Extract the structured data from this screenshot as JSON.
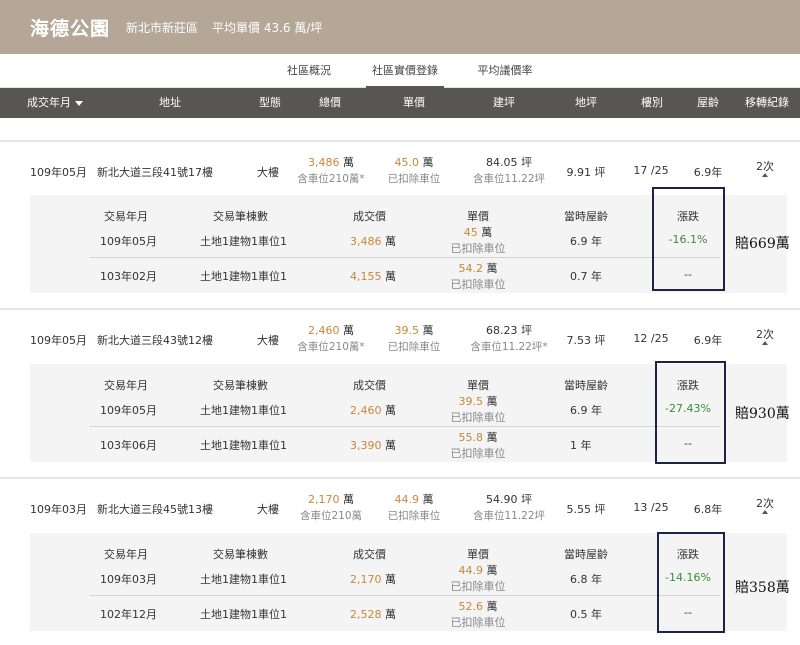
{
  "header": {
    "community_name": "海德公園",
    "region": "新北市新莊區",
    "avg_price": "平均單價 43.6 萬/坪"
  },
  "tabs": [
    {
      "label": "社區概況"
    },
    {
      "label": "社區實價登錄"
    },
    {
      "label": "平均議價率"
    }
  ],
  "columns": {
    "date": "成交年月",
    "address": "地址",
    "type": "型態",
    "total": "總價",
    "unit": "單價",
    "building_area": "建坪",
    "land_area": "地坪",
    "floor": "樓別",
    "age": "屋齡",
    "history": "移轉紀錄"
  },
  "detail_headers": {
    "date": "交易年月",
    "count": "交易筆棟數",
    "price": "成交價",
    "unit": "單價",
    "age": "當時屋齡",
    "change": "漲跌"
  },
  "records": [
    {
      "date": "109年05月",
      "address": "新北大道三段41號17樓",
      "type": "大樓",
      "total": "3,486",
      "total_unit": "萬",
      "total_sub": "含車位210萬*",
      "unit_price": "45.0",
      "unit_price_unit": "萬",
      "unit_sub": "已扣除車位",
      "area": "84.05 坪",
      "area_sub": "含車位11.22坪",
      "land": "9.91 坪",
      "floor": "17 /25",
      "age": "6.9年",
      "history": "2次",
      "transactions": [
        {
          "date": "109年05月",
          "count": "土地1建物1車位1",
          "price": "3,486",
          "price_unit": "萬",
          "unit": "45",
          "unit_unit": "萬",
          "unit_sub": "已扣除車位",
          "age": "6.9 年",
          "change": "-16.1%"
        },
        {
          "date": "103年02月",
          "count": "土地1建物1車位1",
          "price": "4,155",
          "price_unit": "萬",
          "unit": "54.2",
          "unit_unit": "萬",
          "unit_sub": "已扣除車位",
          "age": "0.7 年",
          "change": "--"
        }
      ],
      "loss_note": "賠669萬"
    },
    {
      "date": "109年05月",
      "address": "新北大道三段43號12樓",
      "type": "大樓",
      "total": "2,460",
      "total_unit": "萬",
      "total_sub": "含車位210萬*",
      "unit_price": "39.5",
      "unit_price_unit": "萬",
      "unit_sub": "已扣除車位",
      "area": "68.23 坪",
      "area_sub": "含車位11.22坪*",
      "land": "7.53 坪",
      "floor": "12 /25",
      "age": "6.9年",
      "history": "2次",
      "transactions": [
        {
          "date": "109年05月",
          "count": "土地1建物1車位1",
          "price": "2,460",
          "price_unit": "萬",
          "unit": "39.5",
          "unit_unit": "萬",
          "unit_sub": "已扣除車位",
          "age": "6.9 年",
          "change": "-27.43%"
        },
        {
          "date": "103年06月",
          "count": "土地1建物1車位1",
          "price": "3,390",
          "price_unit": "萬",
          "unit": "55.8",
          "unit_unit": "萬",
          "unit_sub": "已扣除車位",
          "age": "1 年",
          "change": "--"
        }
      ],
      "loss_note": "賠930萬"
    },
    {
      "date": "109年03月",
      "address": "新北大道三段45號13樓",
      "type": "大樓",
      "total": "2,170",
      "total_unit": "萬",
      "total_sub": "含車位210萬",
      "unit_price": "44.9",
      "unit_price_unit": "萬",
      "unit_sub": "已扣除車位",
      "area": "54.90 坪",
      "area_sub": "含車位11.22坪",
      "land": "5.55 坪",
      "floor": "13 /25",
      "age": "6.8年",
      "history": "2次",
      "transactions": [
        {
          "date": "109年03月",
          "count": "土地1建物1車位1",
          "price": "2,170",
          "price_unit": "萬",
          "unit": "44.9",
          "unit_unit": "萬",
          "unit_sub": "已扣除車位",
          "age": "6.8 年",
          "change": "-14.16%"
        },
        {
          "date": "102年12月",
          "count": "土地1建物1車位1",
          "price": "2,528",
          "price_unit": "萬",
          "unit": "52.6",
          "unit_unit": "萬",
          "unit_sub": "已扣除車位",
          "age": "0.5 年",
          "change": "--"
        }
      ],
      "loss_note": "賠358萬"
    }
  ],
  "colors": {
    "header_bg": "#b4a798",
    "table_head_bg": "#585553",
    "price_orange": "#c8873a",
    "change_green": "#3d8c3a",
    "annotation_box": "#1b2346"
  }
}
